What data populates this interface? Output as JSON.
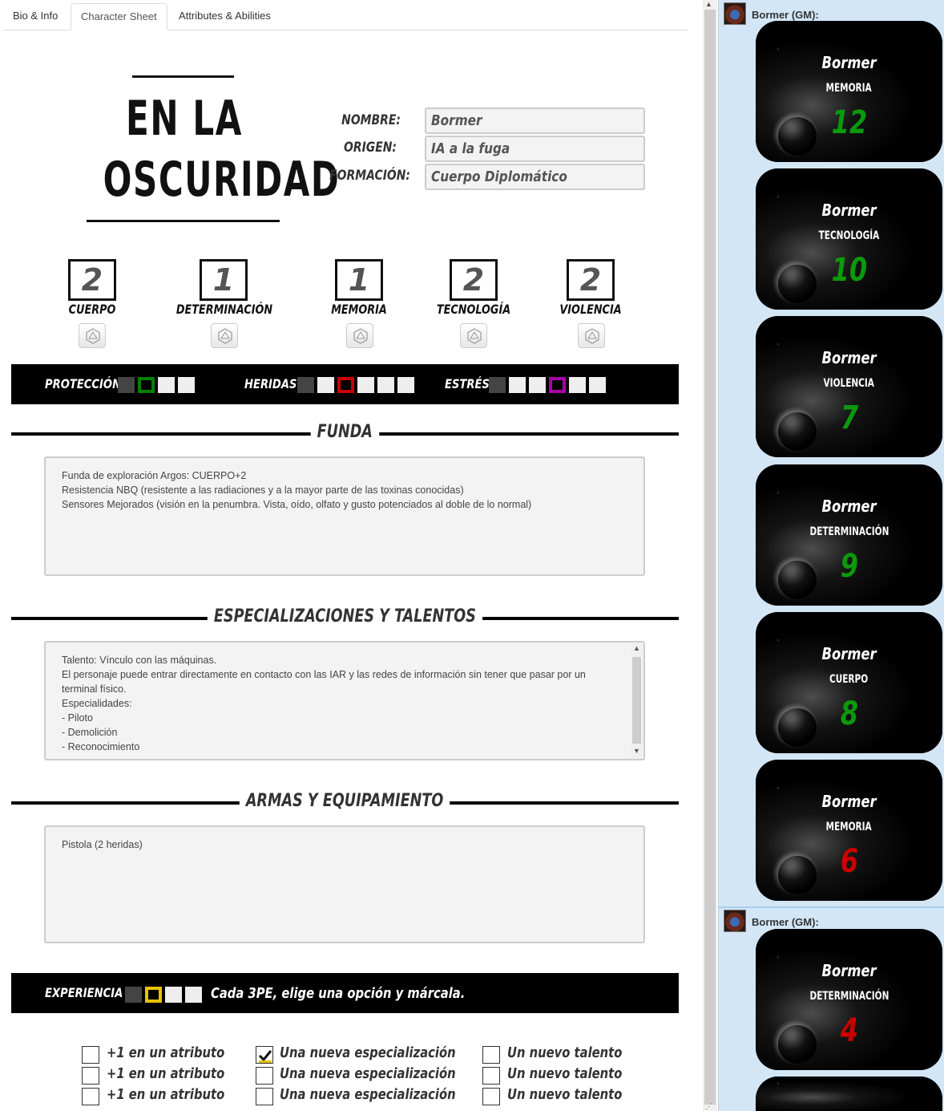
{
  "tabs": [
    {
      "label": "Bio & Info"
    },
    {
      "label": "Character Sheet"
    },
    {
      "label": "Attributes & Abilities"
    }
  ],
  "logo": {
    "line1": "EN LA",
    "line2": "OSCURIDAD"
  },
  "identity": {
    "nombre_label": "NOMBRE:",
    "nombre_value": "Bormer",
    "origen_label": "ORIGEN:",
    "origen_value": "IA a la fuga",
    "formacion_label": "FORMACIÓN:",
    "formacion_value": "Cuerpo Diplomático"
  },
  "attributes": [
    {
      "name": "CUERPO",
      "value": "2"
    },
    {
      "name": "DETERMINACIÓN",
      "value": "1"
    },
    {
      "name": "MEMORIA",
      "value": "1"
    },
    {
      "name": "TECNOLOGÍA",
      "value": "2"
    },
    {
      "name": "VIOLENCIA",
      "value": "2"
    }
  ],
  "trackers": {
    "proteccion_label": "PROTECCIÓN",
    "proteccion_marked_color": "#008000",
    "heridas_label": "HERIDAS",
    "heridas_marked_color": "#cc0000",
    "estres_label": "ESTRÉS",
    "estres_marked_color": "#aa00aa"
  },
  "sections": {
    "funda_title": "FUNDA",
    "funda_text": "Funda de exploración Argos: CUERPO+2\nResistencia NBQ (resistente a las radiaciones y a la mayor parte de las toxinas conocidas)\nSensores Mejorados (visión en la penumbra. Vista, oído, olfato y gusto potenciados al doble de lo normal)",
    "especializaciones_title": "ESPECIALIZACIONES Y TALENTOS",
    "especializaciones_text": "Talento: Vínculo con las máquinas.\nEl personaje puede entrar directamente en contacto con las IAR y las redes de información sin tener que pasar por un terminal físico.\nEspecialidades:\n- Piloto\n- Demolición\n- Reconocimiento",
    "armas_title": "ARMAS Y EQUIPAMIENTO",
    "armas_text": "Pistola (2 heridas)"
  },
  "experience": {
    "label": "EXPERIENCIA",
    "marked_color": "#e6c300",
    "instruction": "Cada 3PE, elige una opción y márcala.",
    "options": {
      "atributo": "+1 en un atributo",
      "especializacion": "Una nueva especialización",
      "talento": "Un nuevo talento"
    },
    "checked_color": "#e6c300"
  },
  "chat": {
    "messages": [
      {
        "sender": "Bormer (GM):"
      },
      {
        "sender": "Bormer (GM):"
      }
    ],
    "cards": [
      {
        "name": "Bormer",
        "attr": "MEMORIA",
        "value": "12",
        "color": "#0a9a0a"
      },
      {
        "name": "Bormer",
        "attr": "TECNOLOGÍA",
        "value": "10",
        "color": "#0a9a0a"
      },
      {
        "name": "Bormer",
        "attr": "VIOLENCIA",
        "value": "7",
        "color": "#0a9a0a"
      },
      {
        "name": "Bormer",
        "attr": "DETERMINACIÓN",
        "value": "9",
        "color": "#0a9a0a"
      },
      {
        "name": "Bormer",
        "attr": "CUERPO",
        "value": "8",
        "color": "#0a9a0a"
      },
      {
        "name": "Bormer",
        "attr": "MEMORIA",
        "value": "6",
        "color": "#cc0000"
      },
      {
        "name": "Bormer",
        "attr": "DETERMINACIÓN",
        "value": "4",
        "color": "#cc0000"
      }
    ]
  }
}
